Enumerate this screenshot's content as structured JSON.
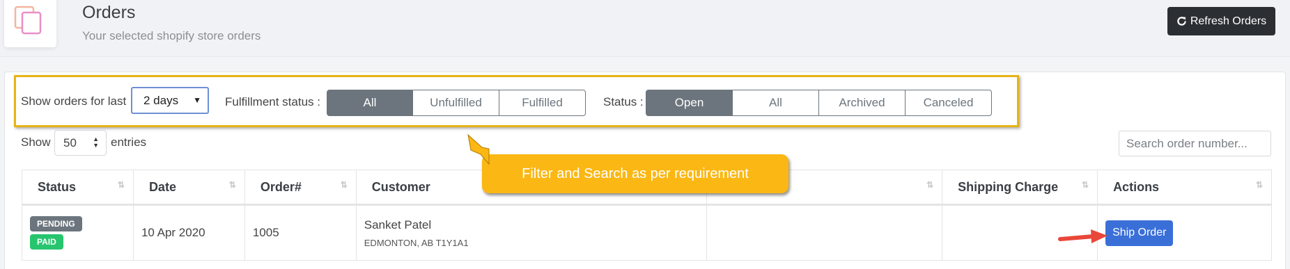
{
  "header": {
    "title": "Orders",
    "subtitle": "Your selected shopify store orders",
    "refresh_label": "Refresh Orders"
  },
  "filters": {
    "show_orders_label": "Show orders for last",
    "days_value": "2 days",
    "fulfillment_label": "Fulfillment status :",
    "fulfillment_options": [
      "All",
      "Unfulfilled",
      "Fulfilled"
    ],
    "fulfillment_selected": "All",
    "status_label": "Status :",
    "status_options": [
      "Open",
      "All",
      "Archived",
      "Canceled"
    ],
    "status_selected": "Open"
  },
  "entries": {
    "show_label": "Show",
    "value": "50",
    "suffix_label": "entries"
  },
  "search": {
    "placeholder": "Search order number..."
  },
  "table": {
    "columns": [
      "Status",
      "Date",
      "Order#",
      "Customer",
      "",
      "Shipping Charge",
      "Actions"
    ],
    "rows": [
      {
        "badges": [
          "PENDING",
          "PAID"
        ],
        "date": "10 Apr 2020",
        "order": "1005",
        "customer_name": "Sanket Patel",
        "customer_address": "EDMONTON, AB T1Y1A1",
        "col5": "",
        "shipping_charge": "",
        "action_label": "Ship Order"
      }
    ]
  },
  "annotation": {
    "callout_text": "Filter and Search as per requirement"
  },
  "colors": {
    "accent_dark": "#2b2f33",
    "segment_active": "#6c757d",
    "highlight_border": "#e7b416",
    "callout": "#fbb713",
    "ship_button": "#3a6fd8",
    "paid_badge": "#28c56f",
    "arrow": "#e8473a"
  }
}
